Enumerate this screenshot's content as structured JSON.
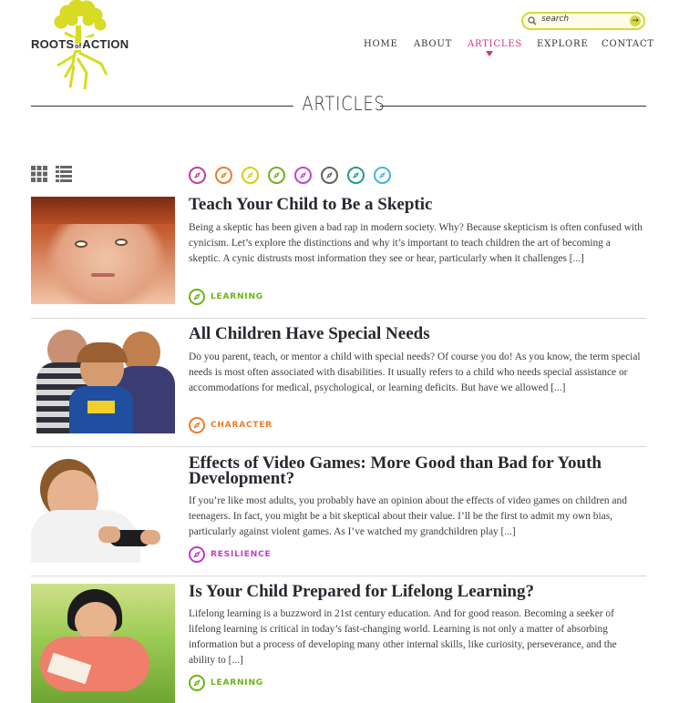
{
  "brand": {
    "name": "ROOTS of ACTION",
    "word_left": "ROOTS",
    "word_right": "ACTION",
    "tree_color": "#d7db24"
  },
  "search": {
    "placeholder": "search",
    "accent": "#d6d83a"
  },
  "nav": {
    "items": [
      {
        "label": "HOME",
        "active": false
      },
      {
        "label": "ABOUT",
        "active": false
      },
      {
        "label": "ARTICLES",
        "active": true
      },
      {
        "label": "EXPLORE",
        "active": false
      },
      {
        "label": "CONTACT",
        "active": false
      }
    ],
    "active_color": "#d4317e"
  },
  "page": {
    "title": "ARTICLES"
  },
  "view_toggle": {
    "grid_icon": "grid-view-icon",
    "list_icon": "list-view-icon"
  },
  "filters": [
    {
      "icon": "compass-icon",
      "color": "#c53d9d"
    },
    {
      "icon": "compass-icon",
      "color": "#f07b22"
    },
    {
      "icon": "compass-icon",
      "color": "#d6cd19"
    },
    {
      "icon": "compass-icon",
      "color": "#70b21d"
    },
    {
      "icon": "compass-icon",
      "color": "#c641d0"
    },
    {
      "icon": "compass-icon",
      "color": "#636363"
    },
    {
      "icon": "compass-icon",
      "color": "#229a8c"
    },
    {
      "icon": "compass-icon",
      "color": "#3fb4e3"
    }
  ],
  "articles": [
    {
      "title": "Teach Your Child to Be a Skeptic",
      "excerpt": "Being a skeptic has been given a bad rap in modern society. Why? Because skepticism is often confused with cynicism. Let’s explore the distinctions and why it’s important to teach children the art of becoming a skeptic. A cynic distrusts most information they see or hear, particularly when it challenges [...]",
      "category": "LEARNING",
      "category_color": "#6db316",
      "image": "skeptical-child-photo"
    },
    {
      "title": "All Children Have Special Needs",
      "excerpt": "Do you parent, teach, or mentor a child with special needs? Of course you do! As you know, the term special needs is most often associated with disabilities. It usually refers to a child who needs special assistance or accommodations for medical, psychological, or learning deficits. But have we allowed [...]",
      "category": "CHARACTER",
      "category_color": "#ef7c23",
      "image": "three-children-photo"
    },
    {
      "title": "Effects of Video Games: More Good than Bad for Youth Development?",
      "excerpt": "If you’re like most adults, you probably have an opinion about the effects of video games on children and teenagers. In fact, you might be a bit skeptical about their value. I’ll be the first to admit my own bias, particularly against violent games. As I’ve watched my grandchildren play [...]",
      "category": "RESILIENCE",
      "category_color": "#c23bcb",
      "image": "boy-video-game-photo"
    },
    {
      "title": "Is Your Child Prepared for Lifelong Learning?",
      "excerpt": "Lifelong learning is a buzzword in 21st century education. And for good reason. Becoming a seeker of lifelong learning is critical in today’s fast-changing world. Learning is not only a matter of absorbing information but a process of developing many other internal skills, like curiosity, perseverance, and the ability to [...]",
      "category": "LEARNING",
      "category_color": "#6db316",
      "image": "girl-reading-photo"
    }
  ]
}
